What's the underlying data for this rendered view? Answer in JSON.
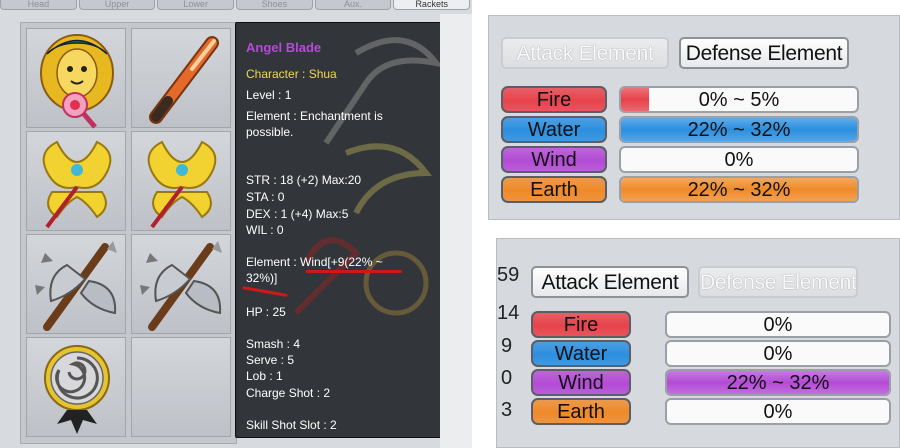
{
  "inventory": {
    "tabs": [
      "Head",
      "Upper",
      "Lower",
      "Shoes",
      "Aux.",
      "Rackets"
    ],
    "active_tab": "Rackets",
    "slots": [
      {
        "icon": "golden-crest-racket-icon"
      },
      {
        "icon": "baseball-bat-icon"
      },
      {
        "icon": "golden-wing-staff-icon"
      },
      {
        "icon": "golden-wing-staff-icon"
      },
      {
        "icon": "spiked-battle-axe-icon"
      },
      {
        "icon": "spiked-battle-axe-icon"
      },
      {
        "icon": "swirl-lollipop-icon"
      },
      {
        "icon": "empty-slot"
      }
    ]
  },
  "tooltip": {
    "title": "Angel Blade",
    "character": "Character : Shua",
    "level": "Level : 1",
    "element_note_1": "Element : Enchantment is",
    "element_note_2": "possible.",
    "str": "STR : 18 (+2) Max:20",
    "sta": "STA : 0",
    "dex": "DEX : 1 (+4) Max:5",
    "wil": "WIL : 0",
    "element_1": "Element : Wind[+9(22% ~",
    "element_2": "32%)]",
    "hp": "HP : 25",
    "smash": "Smash : 4",
    "serve": "Serve : 5",
    "lob": "Lob : 1",
    "charge_shot": "Charge Shot : 2",
    "skill_shot_slot": "Skill Shot Slot : 2"
  },
  "panel_top": {
    "attack_tab": "Attack Element",
    "defense_tab": "Defense Element",
    "active_tab": "Defense Element",
    "rows": [
      {
        "name": "Fire",
        "value": "0% ~ 5%",
        "fill": 0.12
      },
      {
        "name": "Water",
        "value": "22% ~ 32%",
        "fill": 1.0
      },
      {
        "name": "Wind",
        "value": "0%",
        "fill": 0.0
      },
      {
        "name": "Earth",
        "value": "22% ~ 32%",
        "fill": 1.0
      }
    ]
  },
  "panel_bottom": {
    "attack_tab": "Attack Element",
    "defense_tab": "Defense Element",
    "active_tab": "Attack Element",
    "side_numbers": [
      "59",
      "14",
      "9",
      "0",
      "3"
    ],
    "rows": [
      {
        "name": "Fire",
        "value": "0%",
        "fill": 0.0
      },
      {
        "name": "Water",
        "value": "0%",
        "fill": 0.0
      },
      {
        "name": "Wind",
        "value": "22% ~ 32%",
        "fill": 1.0
      },
      {
        "name": "Earth",
        "value": "0%",
        "fill": 0.0
      }
    ]
  },
  "colors": {
    "fire": "#e8424a",
    "water": "#2b8fe0",
    "wind": "#b44bd6",
    "earth": "#f08a28",
    "tooltip_title": "#b64ad9",
    "tooltip_character": "#f0d850",
    "annotation_red": "#d01818"
  }
}
